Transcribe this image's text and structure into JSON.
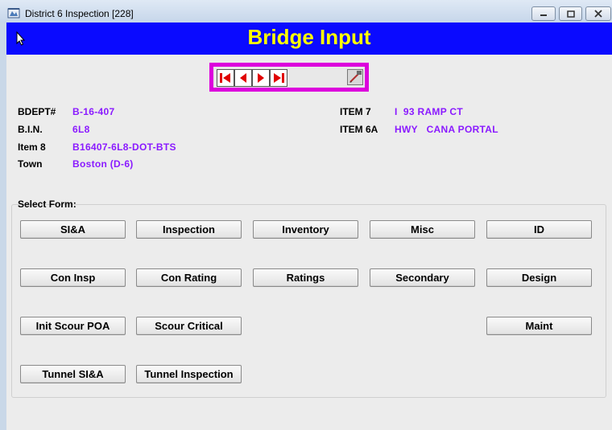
{
  "window": {
    "title": "District 6 Inspection [228]"
  },
  "banner": {
    "title": "Bridge Input"
  },
  "navigator": {
    "buttons": [
      "first-record-icon",
      "previous-record-icon",
      "next-record-icon",
      "last-record-icon"
    ],
    "edit": "edit-pencil-icon"
  },
  "info": {
    "bdept": {
      "label": "BDEPT#",
      "value": "B-16-407"
    },
    "bin": {
      "label": "B.I.N.",
      "value": "6L8"
    },
    "item8": {
      "label": "Item 8",
      "value": "B16407-6L8-DOT-BTS"
    },
    "town": {
      "label": "Town",
      "value": "Boston (D-6)"
    },
    "item7": {
      "label": "ITEM 7",
      "value": "I  93 RAMP CT"
    },
    "item6a": {
      "label": "ITEM 6A",
      "value": "HWY   CANA PORTAL"
    }
  },
  "select_form": {
    "label": "Select Form:",
    "buttons": {
      "sia": "SI&A",
      "inspection": "Inspection",
      "inventory": "Inventory",
      "misc": "Misc",
      "id": "ID",
      "con_insp": "Con Insp",
      "con_rating": "Con Rating",
      "ratings": "Ratings",
      "secondary": "Secondary",
      "design": "Design",
      "init_scour_poa": "Init Scour POA",
      "scour_critical": "Scour Critical",
      "maint": "Maint",
      "tunnel_sia": "Tunnel SI&A",
      "tunnel_inspection": "Tunnel Inspection"
    }
  },
  "colors": {
    "banner_bg": "#0a0aff",
    "banner_text": "#ffff00",
    "value_text": "#8a1aff",
    "nav_border": "#dc00dc",
    "nav_arrows": "#e00000"
  }
}
